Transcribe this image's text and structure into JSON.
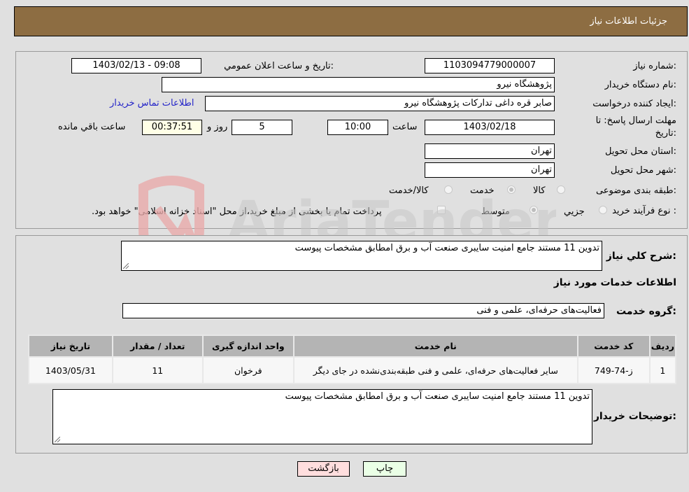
{
  "header": {
    "title": "جزئیات اطلاعات نیاز"
  },
  "form": {
    "need_number": {
      "label": "شماره نیاز:",
      "value": "1103094779000007"
    },
    "announce_datetime": {
      "label": "تاریخ و ساعت اعلان عمومي:",
      "value": "1403/02/13 - 09:08"
    },
    "buyer_org": {
      "label": "نام دستگاه خريدار:",
      "value": "پژوهشگاه نيرو"
    },
    "requester": {
      "label": "ايجاد کننده درخواست:",
      "value": "صابر قره داغی تدارکات پژوهشگاه نیرو"
    },
    "buyer_contact_link": "اطلاعات تماس خريدار",
    "deadline": {
      "label_line1": "مهلت ارسال پاسخ: تا",
      "label_line2": "تاريخ:",
      "date": "1403/02/18",
      "time_label": "ساعت",
      "time": "10:00",
      "days": "5",
      "days_label": "روز و",
      "remaining": "00:37:51",
      "remaining_label": "ساعت باقي مانده"
    },
    "province": {
      "label": "استان محل تحويل:",
      "value": "تهران"
    },
    "city": {
      "label": "شهر محل تحويل:",
      "value": "تهران"
    },
    "category": {
      "label": "طبقه بندی موضوعی:",
      "options": [
        "کالا",
        "خدمت",
        "کالا/خدمت"
      ],
      "selected": "خدمت"
    },
    "purchase_type": {
      "label": "نوع فرآيند خريد :",
      "options": [
        "جزيي",
        "متوسط"
      ],
      "selected": "متوسط",
      "treasury_note": "پرداخت تمام يا بخشی از مبلغ خريد،از محل \"اسناد خزانه اسلامی\" خواهد بود."
    }
  },
  "details": {
    "general_desc_label": "شرح کلي نياز:",
    "general_desc": "تدوین 11 مستند جامع امنیت سایبری صنعت آب و برق امطابق مشخصات پیوست",
    "services_heading": "اطلاعات خدمات مورد نياز",
    "service_group_label": "گروه خدمت:",
    "service_group": "فعاليت‌های حرفه‌ای، علمی و فنی",
    "table": {
      "headers": [
        "رديف",
        "کد خدمت",
        "نام خدمت",
        "واحد اندازه گيری",
        "تعداد / مقدار",
        "تاريخ نياز"
      ],
      "rows": [
        [
          "1",
          "ز-74-749",
          "ساير فعاليت‌های حرفه‌ای، علمی و فنی طبقه‌بندی‌نشده در جای ديگر",
          "فرخوان",
          "11",
          "1403/05/31"
        ]
      ]
    },
    "buyer_notes_label": "توضيحات خريدار:",
    "buyer_notes": "تدوین 11 مستند جامع امنیت سایبری صنعت آب و برق امطابق مشخصات پیوست"
  },
  "buttons": {
    "print": "چاپ",
    "back": "بازگشت"
  },
  "watermark": {
    "text": "AriaTender.neT"
  },
  "colors": {
    "header_bg": "#8d6d42",
    "back_btn": "#ffdede",
    "print_btn": "#eaffe6",
    "remaining_bg": "#ffffe6",
    "link": "#2323c8"
  }
}
